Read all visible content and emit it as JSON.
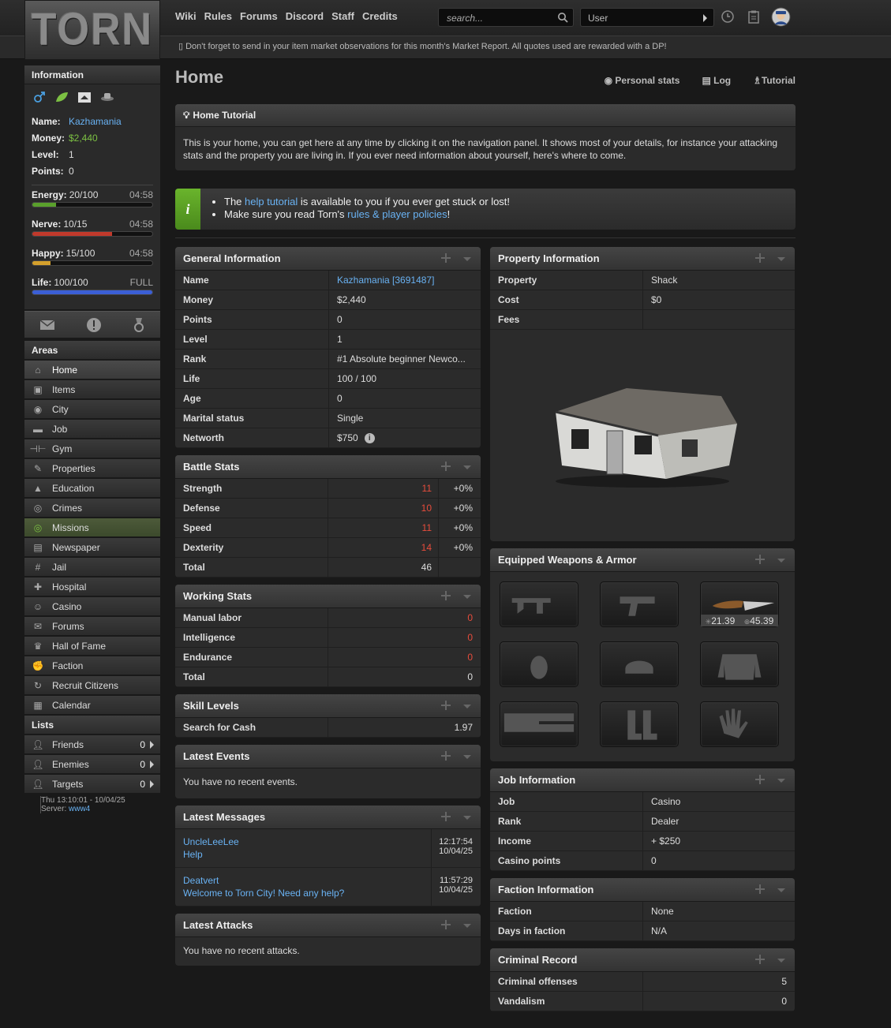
{
  "topnav": [
    "Wiki",
    "Rules",
    "Forums",
    "Discord",
    "Staff",
    "Credits"
  ],
  "logo_text": "TORN",
  "search_placeholder": "search...",
  "user_select": "User",
  "announcement": "Don't forget to send in your item market observations for this month's Market Report. All quotes used are rewarded with a DP!",
  "info": {
    "header": "Information",
    "name_label": "Name:",
    "name": "Kazhamania",
    "money_label": "Money:",
    "money": "$2,440",
    "level_label": "Level:",
    "level": "1",
    "points_label": "Points:",
    "points": "0"
  },
  "bars": [
    {
      "label": "Energy:",
      "value": "20/100",
      "time": "04:58",
      "fraction": 0.2,
      "color": "#5aa02c"
    },
    {
      "label": "Nerve:",
      "value": "10/15",
      "time": "04:58",
      "fraction": 0.667,
      "color": "#c0392b"
    },
    {
      "label": "Happy:",
      "value": "15/100",
      "time": "04:58",
      "fraction": 0.15,
      "color": "#d4a02c"
    },
    {
      "label": "Life:",
      "value": "100/100",
      "time": "FULL",
      "fraction": 1.0,
      "color": "#3b5fd6"
    }
  ],
  "areas_header": "Areas",
  "areas": [
    "Home",
    "Items",
    "City",
    "Job",
    "Gym",
    "Properties",
    "Education",
    "Crimes",
    "Missions",
    "Newspaper",
    "Jail",
    "Hospital",
    "Casino",
    "Forums",
    "Hall of Fame",
    "Faction",
    "Recruit Citizens",
    "Calendar"
  ],
  "lists_header": "Lists",
  "lists": [
    {
      "label": "Friends",
      "count": "0"
    },
    {
      "label": "Enemies",
      "count": "0"
    },
    {
      "label": "Targets",
      "count": "0"
    }
  ],
  "clock": "Thu 13:10:01 - 10/04/25",
  "server_label": "Server:",
  "server": "www4",
  "page_title": "Home",
  "page_links": [
    "Personal stats",
    "Log",
    "Tutorial"
  ],
  "tutorial": {
    "title": "Home Tutorial",
    "text": "This is your home, you can get here at any time by clicking it on the navigation panel. It shows most of your details, for instance your attacking stats and the property you are living in. If you ever need information about yourself, here's where to come."
  },
  "info_msg": {
    "pre1": "The ",
    "link1": "help tutorial",
    "post1": " is available to you if you ever get stuck or lost!",
    "pre2": "Make sure you read Torn's ",
    "link2": "rules & player policies",
    "post2": "!"
  },
  "general": {
    "title": "General Information",
    "rows": [
      [
        "Name",
        "Kazhamania [3691487]"
      ],
      [
        "Money",
        "$2,440"
      ],
      [
        "Points",
        "0"
      ],
      [
        "Level",
        "1"
      ],
      [
        "Rank",
        "#1 Absolute beginner Newco..."
      ],
      [
        "Life",
        "100 / 100"
      ],
      [
        "Age",
        "0"
      ],
      [
        "Marital status",
        "Single"
      ],
      [
        "Networth",
        "$750"
      ]
    ]
  },
  "battle": {
    "title": "Battle Stats",
    "rows": [
      [
        "Strength",
        "11",
        "+0%"
      ],
      [
        "Defense",
        "10",
        "+0%"
      ],
      [
        "Speed",
        "11",
        "+0%"
      ],
      [
        "Dexterity",
        "14",
        "+0%"
      ]
    ],
    "total_label": "Total",
    "total": "46"
  },
  "working": {
    "title": "Working Stats",
    "rows": [
      [
        "Manual labor",
        "0"
      ],
      [
        "Intelligence",
        "0"
      ],
      [
        "Endurance",
        "0"
      ]
    ],
    "total_label": "Total",
    "total": "0"
  },
  "skills": {
    "title": "Skill Levels",
    "rows": [
      [
        "Search for Cash",
        "1.97"
      ]
    ]
  },
  "events": {
    "title": "Latest Events",
    "text": "You have no recent events."
  },
  "messages": {
    "title": "Latest Messages",
    "items": [
      {
        "from": "UncleLeeLee",
        "subject": "Help",
        "time": "12:17:54",
        "date": "10/04/25"
      },
      {
        "from": "Deatvert",
        "subject": "Welcome to Torn City! Need any help?",
        "time": "11:57:29",
        "date": "10/04/25"
      }
    ]
  },
  "attacks": {
    "title": "Latest Attacks",
    "text": "You have no recent attacks."
  },
  "property": {
    "title": "Property Information",
    "rows": [
      [
        "Property",
        "Shack"
      ],
      [
        "Cost",
        "$0"
      ],
      [
        "Fees",
        ""
      ]
    ]
  },
  "weapons": {
    "title": "Equipped Weapons & Armor",
    "knife_dmg": "21.39",
    "knife_acc": "45.39"
  },
  "job": {
    "title": "Job Information",
    "rows": [
      [
        "Job",
        "Casino"
      ],
      [
        "Rank",
        "Dealer"
      ],
      [
        "Income",
        "+ $250"
      ],
      [
        "Casino points",
        "0"
      ]
    ]
  },
  "faction": {
    "title": "Faction Information",
    "rows": [
      [
        "Faction",
        "None"
      ],
      [
        "Days in faction",
        "N/A"
      ]
    ]
  },
  "criminal": {
    "title": "Criminal Record",
    "rows": [
      [
        "Criminal offenses",
        "5"
      ],
      [
        "Vandalism",
        "0"
      ]
    ]
  }
}
